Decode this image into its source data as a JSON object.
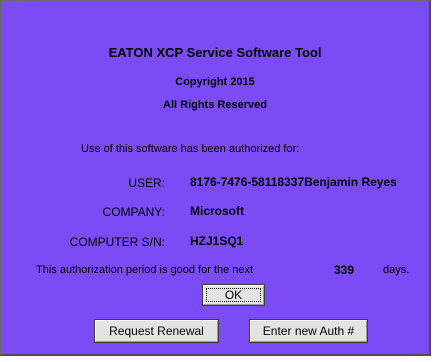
{
  "dialog": {
    "title": "EATON XCP Service Software Tool",
    "copyright": "Copyright 2015",
    "rights": "All Rights Reserved",
    "authorized_text": "Use of this software has been authorized for:",
    "user_label": "USER:",
    "user_value": "8176-7476-58118337Benjamin Reyes",
    "company_label": "COMPANY:",
    "company_value": "Microsoft",
    "computer_label": "COMPUTER S/N:",
    "computer_value": "HZJ1SQ1",
    "period_text": "This authorization period is good for the next",
    "days_count": "339",
    "days_label": "days.",
    "background_color": "#7b4cf6"
  },
  "buttons": {
    "ok_label": "OK",
    "renewal_label": "Request Renewal",
    "auth_label": "Enter new Auth #"
  }
}
